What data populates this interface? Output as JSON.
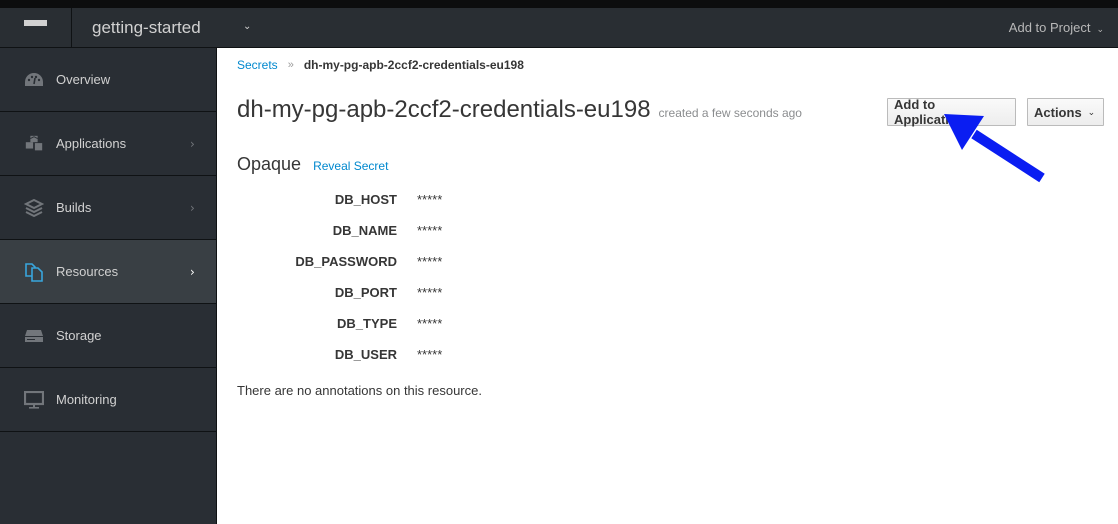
{
  "navbar": {
    "menu_icon": "hamburger-icon",
    "project_name": "getting-started",
    "project_caret": "⌄",
    "add_to_project": "Add to Project",
    "add_caret": "⌄"
  },
  "sidebar": {
    "items": [
      {
        "label": "Overview",
        "icon": "dashboard-icon",
        "has_chevron": false,
        "active": false
      },
      {
        "label": "Applications",
        "icon": "cubes-icon",
        "has_chevron": true,
        "active": false
      },
      {
        "label": "Builds",
        "icon": "layers-icon",
        "has_chevron": true,
        "active": false
      },
      {
        "label": "Resources",
        "icon": "files-icon",
        "has_chevron": true,
        "active": true
      },
      {
        "label": "Storage",
        "icon": "storage-icon",
        "has_chevron": false,
        "active": false
      },
      {
        "label": "Monitoring",
        "icon": "monitor-icon",
        "has_chevron": false,
        "active": false
      }
    ],
    "chevron": "›"
  },
  "breadcrumb": {
    "parent": "Secrets",
    "separator": "»",
    "current": "dh-my-pg-apb-2ccf2-credentials-eu198"
  },
  "header": {
    "title": "dh-my-pg-apb-2ccf2-credentials-eu198",
    "created": "created a few seconds ago",
    "add_to_application": "Add to Application",
    "actions": "Actions",
    "actions_caret": "⌄"
  },
  "secret": {
    "type": "Opaque",
    "reveal_label": "Reveal Secret",
    "entries": [
      {
        "key": "DB_HOST",
        "value": "*****"
      },
      {
        "key": "DB_NAME",
        "value": "*****"
      },
      {
        "key": "DB_PASSWORD",
        "value": "*****"
      },
      {
        "key": "DB_PORT",
        "value": "*****"
      },
      {
        "key": "DB_TYPE",
        "value": "*****"
      },
      {
        "key": "DB_USER",
        "value": "*****"
      }
    ]
  },
  "annotations_text": "There are no annotations on this resource.",
  "colors": {
    "link": "#0088ce",
    "nav_bg": "#292e34",
    "nav_active_bg": "#393f44",
    "active_icon": "#39a5dc",
    "annotation_arrow": "#0a1df2"
  }
}
